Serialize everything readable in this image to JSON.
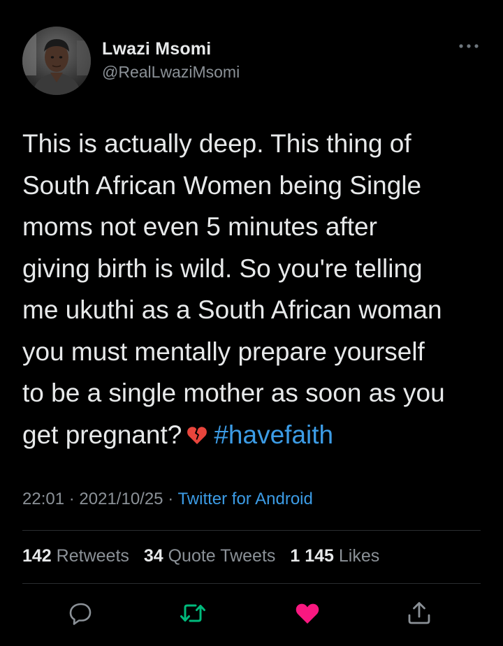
{
  "author": {
    "name": "Lwazi Msomi",
    "handle": "@RealLwaziMsomi"
  },
  "tweet": {
    "lines": [
      "This is actually deep. This thing of",
      "South African Women being Single",
      "moms not even 5 minutes after",
      "giving birth is wild. So you're telling",
      "me ukuthi as a South African woman",
      "you must mentally prepare yourself",
      "to be a single mother as soon as you"
    ],
    "last_line_text": "get pregnant?",
    "emoji": "broken-heart",
    "hashtag": "#havefaith"
  },
  "meta": {
    "time": "22:01",
    "separator": "·",
    "date": "2021/10/25",
    "source": "Twitter for Android"
  },
  "stats": {
    "retweets_count": "142",
    "retweets_label": "Retweets",
    "quotes_count": "34",
    "quotes_label": "Quote Tweets",
    "likes_count": "1 145",
    "likes_label": "Likes"
  },
  "actions": [
    "reply-icon",
    "retweet-icon",
    "like-icon",
    "share-icon"
  ],
  "colors": {
    "background": "#000000",
    "text": "#e7e9ea",
    "secondary": "#8b9197",
    "link": "#3c9ce6",
    "retweet_green": "#00ba7c",
    "like_red": "#f91880"
  }
}
